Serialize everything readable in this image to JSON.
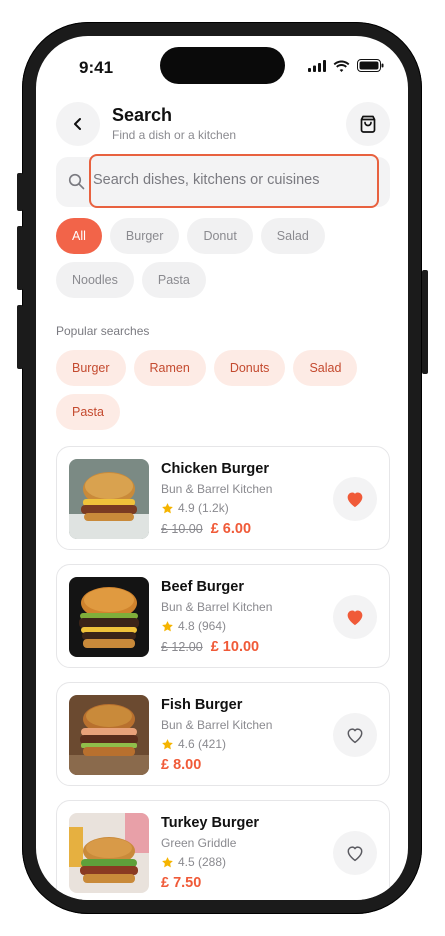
{
  "status": {
    "time": "9:41"
  },
  "header": {
    "title": "Search",
    "subtitle": "Find a dish or a kitchen"
  },
  "search": {
    "placeholder": "Search dishes, kitchens or cuisines",
    "value": ""
  },
  "filters": [
    "All",
    "Burger",
    "Donut",
    "Salad",
    "Noodles",
    "Pasta"
  ],
  "active_filter": "All",
  "popular": {
    "label": "Popular searches",
    "items": [
      "Burger",
      "Ramen",
      "Donuts",
      "Salad",
      "Pasta"
    ]
  },
  "results": [
    {
      "name": "Chicken Burger",
      "kitchen": "Bun & Barrel Kitchen",
      "rating": "4.9 (1.2k)",
      "old_price": "£ 10.00",
      "price": "£ 6.00",
      "favorite": true
    },
    {
      "name": "Beef Burger",
      "kitchen": "Bun & Barrel Kitchen",
      "rating": "4.8 (964)",
      "old_price": "£ 12.00",
      "price": "£ 10.00",
      "favorite": true
    },
    {
      "name": "Fish Burger",
      "kitchen": "Bun & Barrel Kitchen",
      "rating": "4.6 (421)",
      "old_price": "",
      "price": "£ 8.00",
      "favorite": false
    },
    {
      "name": "Turkey Burger",
      "kitchen": "Green Griddle",
      "rating": "4.5 (288)",
      "old_price": "",
      "price": "£ 7.50",
      "favorite": false
    }
  ],
  "colors": {
    "accent": "#f26449",
    "price": "#f05a38",
    "star": "#f5b400",
    "chip_bg": "#f1f1f2",
    "popular_bg": "#fdebe5"
  },
  "icons": {
    "back": "chevron-left-icon",
    "cart": "shopping-bag-icon",
    "search": "search-icon",
    "star": "star-icon",
    "heart": "heart-icon"
  }
}
